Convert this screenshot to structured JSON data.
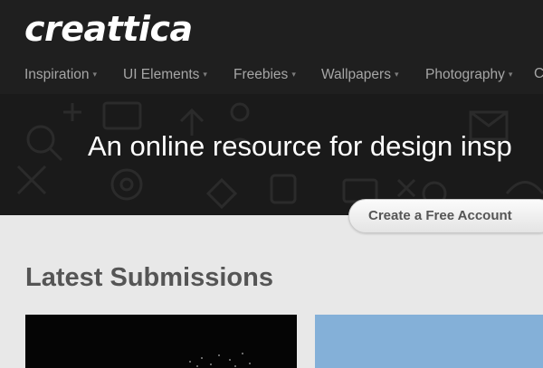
{
  "site": {
    "logo": "creattica"
  },
  "nav": {
    "items": [
      {
        "label": "Inspiration"
      },
      {
        "label": "UI Elements"
      },
      {
        "label": "Freebies"
      },
      {
        "label": "Wallpapers"
      },
      {
        "label": "Photography"
      },
      {
        "label": "C"
      }
    ],
    "caret": "▾"
  },
  "hero": {
    "tagline": "An online resource for design insp"
  },
  "cta": {
    "label": "Create a Free Account"
  },
  "main": {
    "section_title": "Latest Submissions"
  },
  "colors": {
    "header_bg": "#1f1f1f",
    "page_bg": "#e8e8e8",
    "thumb_blue": "#84b0d8"
  }
}
